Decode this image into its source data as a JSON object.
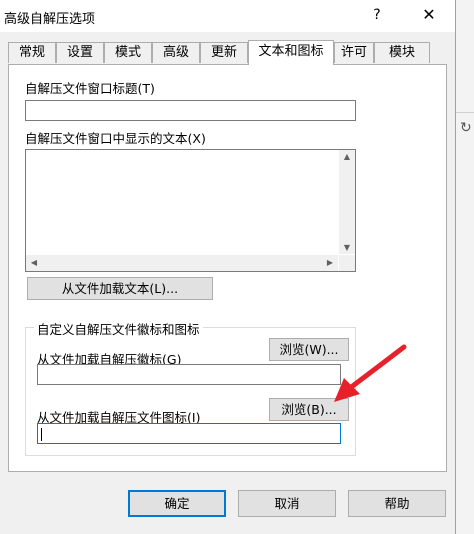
{
  "window": {
    "title": "高级自解压选项",
    "help_symbol": "?",
    "close_symbol": "✕"
  },
  "tabs": [
    {
      "label": "常规",
      "active": false
    },
    {
      "label": "设置",
      "active": false
    },
    {
      "label": "模式",
      "active": false
    },
    {
      "label": "高级",
      "active": false
    },
    {
      "label": "更新",
      "active": false
    },
    {
      "label": "文本和图标",
      "active": true
    },
    {
      "label": "许可",
      "active": false
    },
    {
      "label": "模块",
      "active": false
    }
  ],
  "panel": {
    "title_label": "自解压文件窗口标题(T)",
    "title_value": "",
    "text_label": "自解压文件窗口中显示的文本(X)",
    "text_value": "",
    "load_text_button": "从文件加载文本(L)...",
    "group": {
      "title": "自定义自解压文件徽标和图标",
      "logo_label": "从文件加载自解压徽标(G)",
      "logo_browse": "浏览(W)...",
      "logo_value": "",
      "icon_label": "从文件加载自解压文件图标(I)",
      "icon_browse": "浏览(B)...",
      "icon_value": ""
    }
  },
  "footer": {
    "ok": "确定",
    "cancel": "取消",
    "help": "帮助"
  },
  "colors": {
    "accent": "#0078d7",
    "annotation_arrow": "#e8202a",
    "dialog_bg": "#f0f0f0"
  },
  "icons": {
    "refresh": "refresh-icon"
  }
}
